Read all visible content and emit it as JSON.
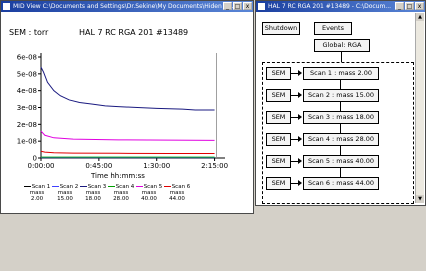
{
  "mid_window": {
    "title": "MID View  C:\\Documents and Settings\\Dr.Sekine\\My Documents\\Hiden An...",
    "minimize": "_",
    "maximize": "□",
    "close": "x"
  },
  "flow_window": {
    "title": "HAL 7 RC RGA 201 #13489 - C:\\Docum...",
    "minimize": "_",
    "maximize": "□",
    "close": "x",
    "nodes": {
      "shutdown": "Shutdown",
      "events": "Events",
      "global": "Global: RGA",
      "sem": "SEM",
      "scans": [
        "Scan 1 : mass 2.00",
        "Scan 2 : mass 15.00",
        "Scan 3 : mass 18.00",
        "Scan 4 : mass 28.00",
        "Scan 5 : mass 40.00",
        "Scan 6 : mass 44.00"
      ]
    }
  },
  "chart_data": {
    "type": "line",
    "title": "HAL 7 RC RGA 201 #13489",
    "ylabel": "SEM : torr",
    "xlabel": "Time  hh:mm:ss",
    "x_ticks": [
      "0:00:00",
      "0:45:00",
      "1:30:00",
      "2:15:00"
    ],
    "y_ticks": [
      "0",
      "1e-08",
      "2e-08",
      "3e-08",
      "4e-08",
      "5e-08",
      "6e-08"
    ],
    "ylim": [
      0,
      6e-08
    ],
    "xlim_minutes": [
      0,
      140
    ],
    "grid": false,
    "legend_position": "bottom",
    "series": [
      {
        "name": "Scan 1\nmass\n2.00",
        "color": "#000000",
        "x": [
          0,
          20,
          60,
          100,
          135
        ],
        "y": [
          3e-10,
          3e-10,
          3e-10,
          3e-10,
          3e-10
        ]
      },
      {
        "name": "Scan 2\nmass\n15.00",
        "color": "#4040ff",
        "x": [
          0,
          20,
          60,
          100,
          135
        ],
        "y": [
          2e-10,
          2e-10,
          2e-10,
          2e-10,
          2e-10
        ]
      },
      {
        "name": "Scan 3\nmass\n18.00",
        "color": "#1a1a80",
        "x": [
          0,
          2,
          5,
          10,
          15,
          22,
          30,
          40,
          50,
          60,
          75,
          90,
          110,
          120,
          128,
          135
        ],
        "y": [
          5.4e-08,
          5.1e-08,
          4.5e-08,
          4e-08,
          3.7e-08,
          3.45e-08,
          3.3e-08,
          3.2e-08,
          3.1e-08,
          3.05e-08,
          3e-08,
          2.95e-08,
          2.9e-08,
          2.85e-08,
          2.85e-08,
          2.85e-08
        ]
      },
      {
        "name": "Scan 4\nmass\n28.00",
        "color": "#00a000",
        "x": [
          0,
          20,
          60,
          100,
          135
        ],
        "y": [
          5e-10,
          5e-10,
          5e-10,
          5e-10,
          5e-10
        ]
      },
      {
        "name": "Scan 5\nmass\n40.00",
        "color": "#e000e0",
        "x": [
          0,
          3,
          10,
          25,
          60,
          100,
          135
        ],
        "y": [
          1.6e-08,
          1.35e-08,
          1.2e-08,
          1.12e-08,
          1.08e-08,
          1.06e-08,
          1.05e-08
        ]
      },
      {
        "name": "Scan 6\nmass\n44.00",
        "color": "#e00000",
        "x": [
          0,
          3,
          10,
          25,
          60,
          100,
          135
        ],
        "y": [
          4e-09,
          3.5e-09,
          3.1e-09,
          2.9e-09,
          2.8e-09,
          2.7e-09,
          2.7e-09
        ]
      }
    ]
  }
}
